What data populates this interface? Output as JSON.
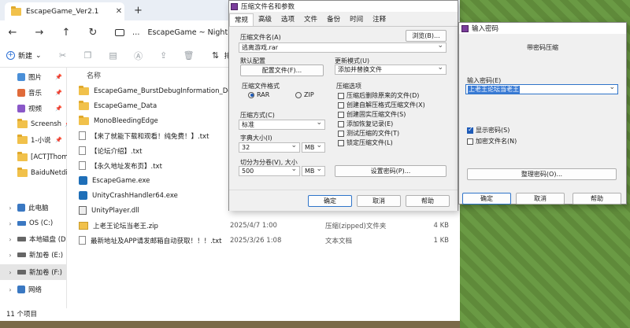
{
  "explorer": {
    "tab_title": "EscapeGame_Ver2.1",
    "tab_close": "✕",
    "new_tab": "+",
    "nav": {
      "back": "←",
      "forward": "→",
      "up": "↑",
      "refresh": "↻"
    },
    "breadcrumb_more": "…",
    "breadcrumb": "EscapeGame ~ Nightm",
    "toolbar": {
      "new_label": "新建",
      "new_chevron": "⌄",
      "sort_label": "排"
    },
    "sidebar": [
      {
        "label": "图片",
        "icon": "pictures-icon",
        "color": "#4a8fd8",
        "pinned": true
      },
      {
        "label": "音乐",
        "icon": "music-icon",
        "color": "#e06b3a",
        "pinned": true
      },
      {
        "label": "视频",
        "icon": "video-icon",
        "color": "#8a58c8",
        "pinned": true
      },
      {
        "label": "Screensh",
        "icon": "folder-icon",
        "color": "#f1c14b",
        "pinned": true
      },
      {
        "label": "1-小说",
        "icon": "folder-icon",
        "color": "#f1c14b",
        "pinned": true
      },
      {
        "label": "[ACT]Thoms",
        "icon": "folder-icon",
        "color": "#f1c14b",
        "pinned": false
      },
      {
        "label": "BaiduNetdi",
        "icon": "folder-icon",
        "color": "#f1c14b",
        "pinned": false
      },
      {
        "label": "此电脑",
        "icon": "this-pc-icon",
        "color": "#3a78c2",
        "pinned": false,
        "expanded": true
      },
      {
        "label": "OS (C:)",
        "icon": "drive-icon",
        "color": "#3a78c2",
        "pinned": false
      },
      {
        "label": "本地磁盘 (D",
        "icon": "drive-icon",
        "color": "#666666",
        "pinned": false
      },
      {
        "label": "新加卷 (E:)",
        "icon": "drive-icon",
        "color": "#666666",
        "pinned": false
      },
      {
        "label": "新加卷 (F:)",
        "icon": "drive-icon",
        "color": "#666666",
        "pinned": false,
        "selected": true
      },
      {
        "label": "网络",
        "icon": "network-icon",
        "color": "#3a78c2",
        "pinned": false
      }
    ],
    "pin_glyph": "📌",
    "chevron_glyph": "›",
    "column_name": "名称",
    "files": [
      {
        "name": "EscapeGame_BurstDebugInformation_DoN...",
        "icon": "folder",
        "date": "",
        "type": "",
        "size": ""
      },
      {
        "name": "EscapeGame_Data",
        "icon": "folder",
        "date": "",
        "type": "",
        "size": ""
      },
      {
        "name": "MonoBleedingEdge",
        "icon": "folder",
        "date": "",
        "type": "",
        "size": ""
      },
      {
        "name": "【来了就能下载和观看！纯免费！】.txt",
        "icon": "file",
        "date": "",
        "type": "",
        "size": ""
      },
      {
        "name": "【论坛介绍】.txt",
        "icon": "file",
        "date": "",
        "type": "",
        "size": ""
      },
      {
        "name": "【永久地址发布页】.txt",
        "icon": "file",
        "date": "",
        "type": "",
        "size": ""
      },
      {
        "name": "EscapeGame.exe",
        "icon": "exe",
        "date": "",
        "type": "",
        "size": ""
      },
      {
        "name": "UnityCrashHandler64.exe",
        "icon": "exe",
        "date": "",
        "type": "",
        "size": ""
      },
      {
        "name": "UnityPlayer.dll",
        "icon": "dll",
        "date": "",
        "type": "",
        "size": ""
      },
      {
        "name": "上老王论坛当老王.zip",
        "icon": "zip",
        "date": "2025/4/7 1:00",
        "type": "压缩(zipped)文件夹",
        "size": "4 KB"
      },
      {
        "name": "最新地址及APP请发邮箱自动获取！！！.txt",
        "icon": "file",
        "date": "2025/3/26 1:08",
        "type": "文本文档",
        "size": "1 KB"
      }
    ],
    "status": "11 个项目"
  },
  "archive_dialog": {
    "title": "压缩文件名和参数",
    "tabs": [
      "常规",
      "高级",
      "选项",
      "文件",
      "备份",
      "时间",
      "注释"
    ],
    "archive_name_label": "压缩文件名(A)",
    "browse_button": "浏览(B)...",
    "archive_name": "逃离游戏.rar",
    "default_profile_label": "默认配置",
    "profiles_button": "配置文件(F)...",
    "update_mode_label": "更新模式(U)",
    "update_mode": "添加并替换文件",
    "format_label": "压缩文件格式",
    "format_rar": "RAR",
    "format_zip": "ZIP",
    "format_selected": "RAR",
    "options_label": "压缩选项",
    "options": [
      {
        "label": "压缩后删除原来的文件(D)",
        "checked": false
      },
      {
        "label": "创建自解压格式压缩文件(X)",
        "checked": false
      },
      {
        "label": "创建固实压缩文件(S)",
        "checked": false
      },
      {
        "label": "添加恢复记录(E)",
        "checked": false
      },
      {
        "label": "测试压缩的文件(T)",
        "checked": false
      },
      {
        "label": "锁定压缩文件(L)",
        "checked": false
      }
    ],
    "method_label": "压缩方式(C)",
    "method": "标准",
    "dict_label": "字典大小(I)",
    "dict_value": "32",
    "dict_unit": "MB",
    "split_label": "切分为分卷(V), 大小",
    "split_value": "500",
    "split_unit": "MB",
    "set_password_button": "设置密码(P)...",
    "ok_button": "确定",
    "cancel_button": "取消",
    "help_button": "帮助"
  },
  "password_dialog": {
    "title": "输入密码",
    "group_title": "带密码压缩",
    "password_label": "输入密码(E)",
    "password_value": "上老王论坛当老王",
    "show_password_label": "显示密码(S)",
    "show_password_checked": true,
    "encrypt_names_label": "加密文件名(N)",
    "encrypt_names_checked": false,
    "organize_button": "整理密码(O)...",
    "ok_button": "确定",
    "cancel_button": "取消",
    "help_button": "帮助"
  }
}
